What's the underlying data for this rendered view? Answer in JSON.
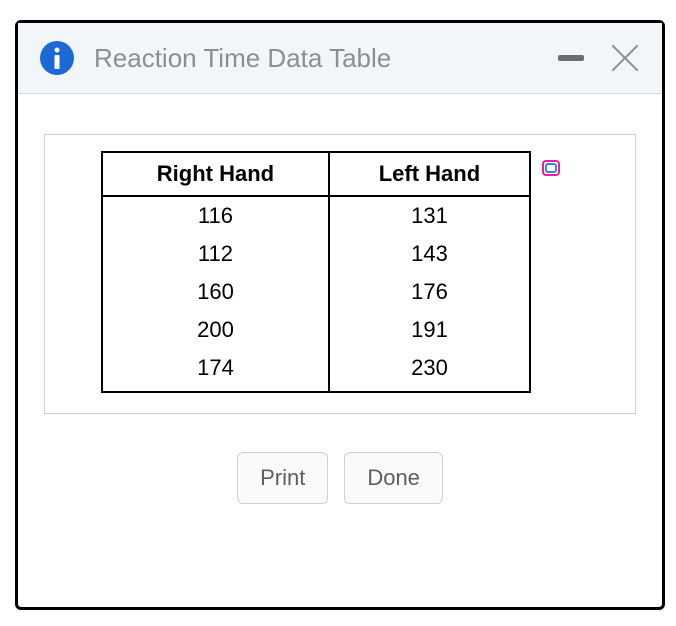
{
  "dialog": {
    "title": "Reaction Time Data Table"
  },
  "table": {
    "headers": [
      "Right Hand",
      "Left Hand"
    ],
    "rows": [
      [
        "116",
        "131"
      ],
      [
        "112",
        "143"
      ],
      [
        "160",
        "176"
      ],
      [
        "200",
        "191"
      ],
      [
        "174",
        "230"
      ]
    ]
  },
  "buttons": {
    "print": "Print",
    "done": "Done"
  },
  "chart_data": {
    "type": "table",
    "title": "Reaction Time Data Table",
    "columns": [
      "Right Hand",
      "Left Hand"
    ],
    "data": [
      {
        "Right Hand": 116,
        "Left Hand": 131
      },
      {
        "Right Hand": 112,
        "Left Hand": 143
      },
      {
        "Right Hand": 160,
        "Left Hand": 176
      },
      {
        "Right Hand": 200,
        "Left Hand": 191
      },
      {
        "Right Hand": 174,
        "Left Hand": 230
      }
    ]
  }
}
